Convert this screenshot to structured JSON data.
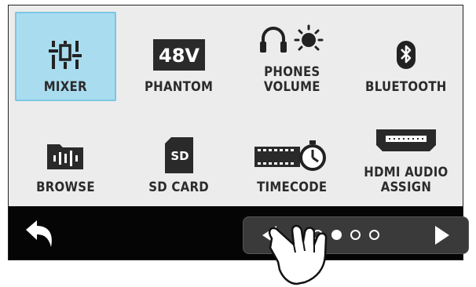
{
  "menu": {
    "tiles": [
      {
        "label": "MIXER",
        "icon": "mixer-icon",
        "selected": true
      },
      {
        "label": "PHANTOM",
        "icon": "phantom-48v-icon",
        "badge": "48V"
      },
      {
        "label": "PHONES\nVOLUME",
        "icon": "headphones-volume-icon"
      },
      {
        "label": "BLUETOOTH",
        "icon": "bluetooth-icon"
      },
      {
        "label": "BROWSE",
        "icon": "folder-waveform-icon"
      },
      {
        "label": "SD CARD",
        "icon": "sd-card-icon",
        "badge": "SD"
      },
      {
        "label": "TIMECODE",
        "icon": "timecode-icon"
      },
      {
        "label": "HDMI AUDIO\nASSIGN",
        "icon": "hdmi-icon"
      }
    ]
  },
  "navigation": {
    "back_icon": "back-arrow-icon",
    "pager": {
      "prev_icon": "triangle-left-icon",
      "next_icon": "triangle-right-icon",
      "pages": 4,
      "current": 2
    }
  },
  "colors": {
    "selected_tile": "#a9dcef",
    "grid_background": "#ececec",
    "bar_background": "#050505"
  }
}
